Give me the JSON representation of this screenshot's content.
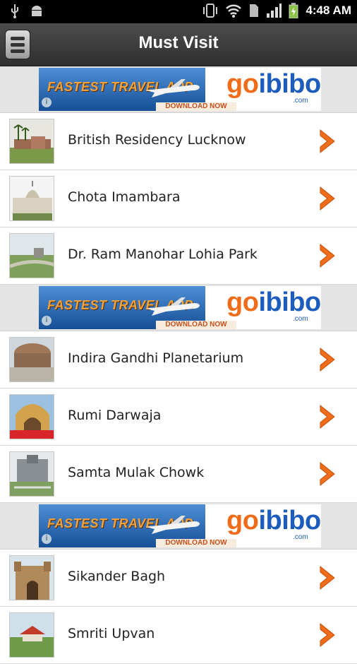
{
  "statusbar": {
    "time": "4:48 AM"
  },
  "header": {
    "title": "Must Visit"
  },
  "ad": {
    "headline": "FASTEST TRAVEL APP",
    "cta": "DOWNLOAD NOW",
    "brand_go": "go",
    "brand_ibibo": "ibibo",
    "brand_suffix": ".com"
  },
  "places": [
    {
      "label": "British Residency Lucknow"
    },
    {
      "label": "Chota Imambara"
    },
    {
      "label": "Dr. Ram Manohar Lohia Park"
    },
    {
      "label": "Indira Gandhi Planetarium"
    },
    {
      "label": "Rumi Darwaja"
    },
    {
      "label": "Samta Mulak Chowk"
    },
    {
      "label": "Sikander Bagh"
    },
    {
      "label": "Smriti Upvan"
    }
  ],
  "colors": {
    "accent": "#ef6c1a",
    "brand_blue": "#1b5cbd",
    "header": "#3a3a3a"
  }
}
